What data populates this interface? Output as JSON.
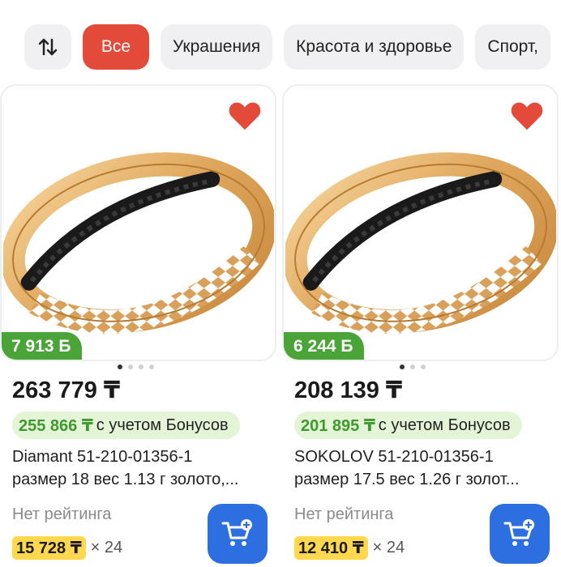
{
  "filters": {
    "sort_icon": "sort-arrows-icon",
    "chips": [
      {
        "label": "Все",
        "active": true
      },
      {
        "label": "Украшения",
        "active": false
      },
      {
        "label": "Красота и здоровье",
        "active": false
      },
      {
        "label": "Спорт,",
        "active": false
      }
    ]
  },
  "colors": {
    "accent": "#e34a39",
    "bonus_green": "#4aa437",
    "cart_blue": "#2d6ee0",
    "installment_yellow": "#ffd84d"
  },
  "products": [
    {
      "bonus_badge": "7 913 Б",
      "price": "263 779 ₸",
      "bonus_price_value": "255 866 ₸",
      "bonus_price_suffix": "с учетом Бонусов",
      "title_line1": "Diamant 51-210-01356-1",
      "title_line2": "размер 18 вес 1.13 г золото,...",
      "rating": "Нет рейтинга",
      "installment_amount": "15 728 ₸",
      "installment_months": "× 24",
      "favorite": true
    },
    {
      "bonus_badge": "6 244 Б",
      "price": "208 139 ₸",
      "bonus_price_value": "201 895 ₸",
      "bonus_price_suffix": "с учетом Бонусов",
      "title_line1": "SOKOLOV 51-210-01356-1",
      "title_line2": "размер 17.5 вес 1.26 г золот...",
      "rating": "Нет рейтинга",
      "installment_amount": "12 410 ₸",
      "installment_months": "× 24",
      "favorite": true
    }
  ]
}
